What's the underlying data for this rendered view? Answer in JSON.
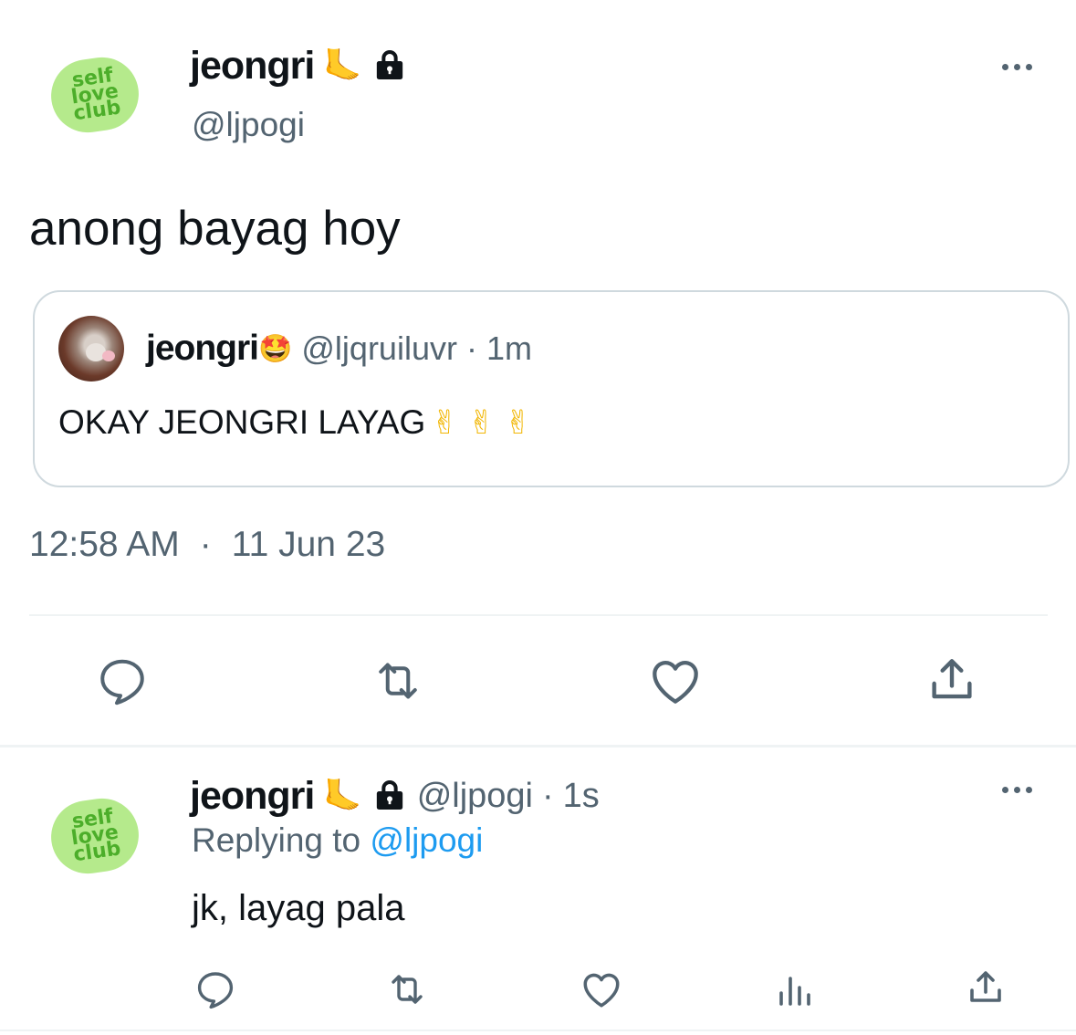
{
  "main_tweet": {
    "avatar_text": [
      "self",
      "love",
      "club"
    ],
    "display_name": "jeongri",
    "name_emoji": "🦶",
    "handle": "@ljpogi",
    "text": "anong bayag hoy",
    "time": "12:58 AM",
    "separator": "·",
    "date": "11 Jun 23"
  },
  "quoted_tweet": {
    "display_name": "jeongri",
    "name_emoji": "🤩",
    "handle": "@ljqruiluvr",
    "sep": "·",
    "age": "1m",
    "text": "OKAY JEONGRI LAYAG",
    "emojis": "✌ ✌ ✌"
  },
  "reply": {
    "avatar_text": [
      "self",
      "love",
      "club"
    ],
    "display_name": "jeongri",
    "name_emoji": "🦶",
    "handle": "@ljpogi",
    "sep": "·",
    "age": "1s",
    "replying_prefix": "Replying to",
    "replying_handle": "@ljpogi",
    "text": "jk, layag pala"
  },
  "icons": [
    "comment-icon",
    "retweet-icon",
    "like-icon",
    "share-icon",
    "views-icon",
    "lock-icon",
    "more-icon"
  ],
  "colors": {
    "accent": "#1d9bf0",
    "muted": "#536471",
    "logo_green": "#4cae2a"
  }
}
